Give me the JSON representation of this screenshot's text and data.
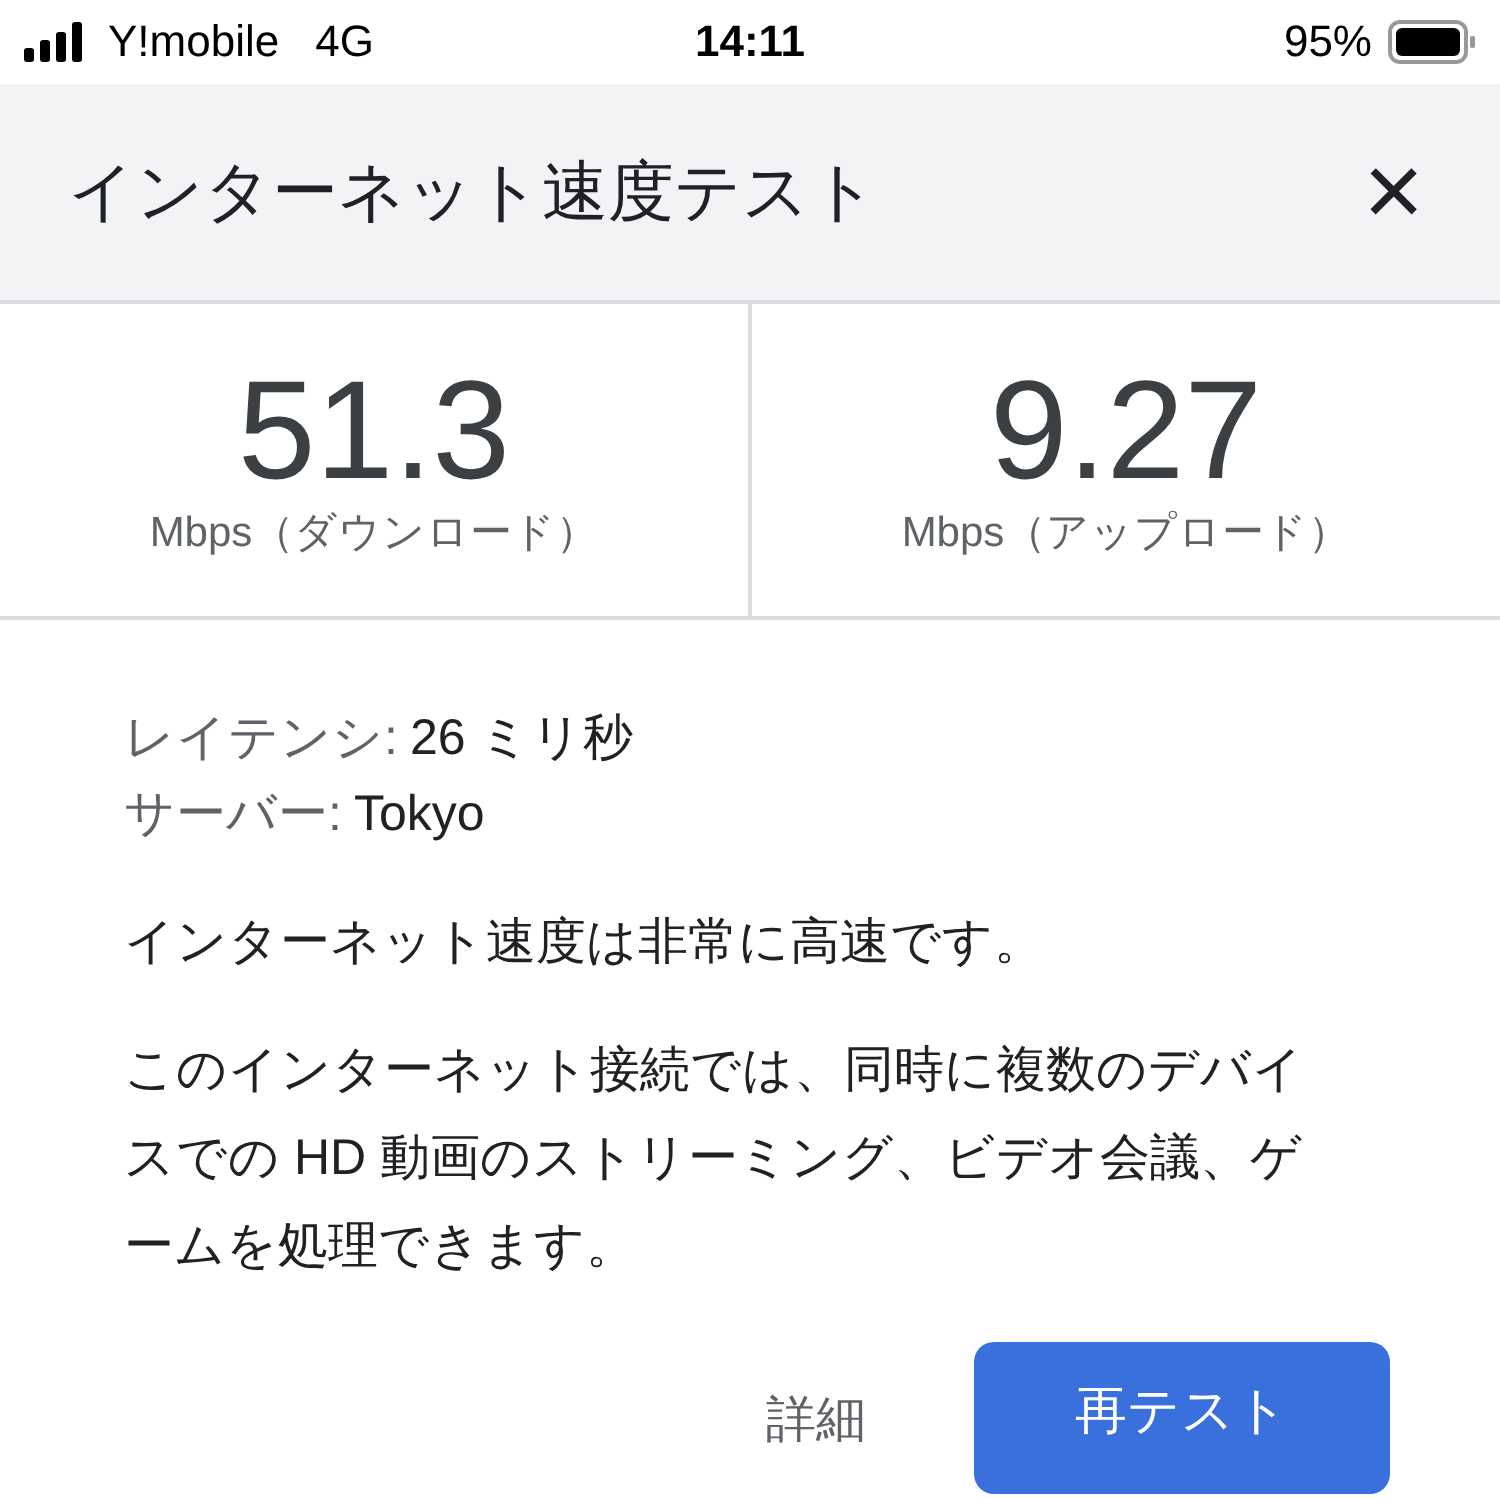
{
  "status_bar": {
    "carrier": "Y!mobile",
    "network": "4G",
    "time": "14:11",
    "battery": "95%"
  },
  "header": {
    "title": "インターネット速度テスト",
    "close": "×"
  },
  "results": [
    {
      "value": "51.3",
      "label": "Mbps（ダウンロード）"
    },
    {
      "value": "9.27",
      "label": "Mbps（アップロード）"
    }
  ],
  "details": [
    {
      "label": "レイテンシ:",
      "value": "26 ミリ秒"
    },
    {
      "label": "サーバー:",
      "value": "Tokyo"
    }
  ],
  "summary": "インターネット速度は非常に高速です。",
  "description": "このインターネット接続では、同時に複数のデバイスでの HD 動画のストリーミング、ビデオ会議、ゲームを処理できます。",
  "buttons": {
    "details": "詳細",
    "retest": "再テスト"
  }
}
